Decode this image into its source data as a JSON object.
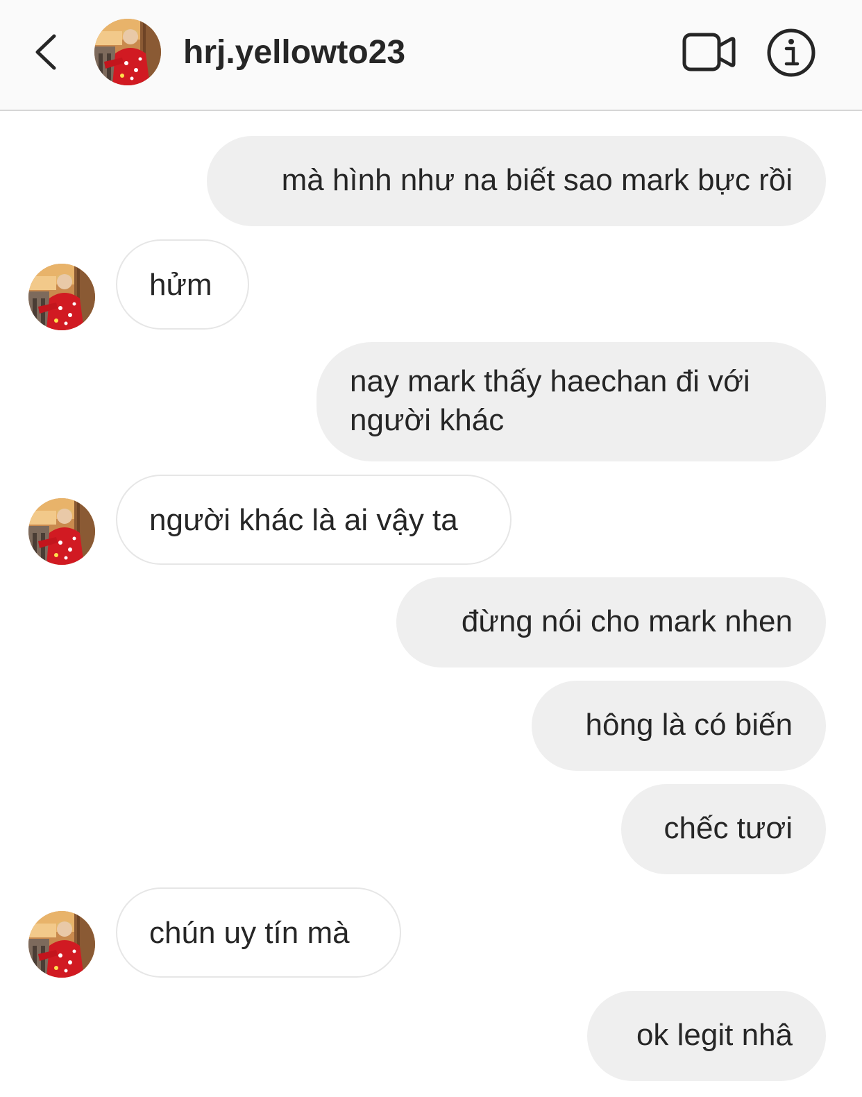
{
  "header": {
    "username": "hrj.yellowto23",
    "back_icon": "chevron-left-icon",
    "video_icon": "video-camera-icon",
    "info_icon": "info-icon"
  },
  "messages": [
    {
      "direction": "outgoing",
      "text": "mà hình như na biết sao mark bực rồi"
    },
    {
      "direction": "incoming",
      "text": "hửm"
    },
    {
      "direction": "outgoing",
      "text": "nay mark thấy haechan đi với người khác"
    },
    {
      "direction": "incoming",
      "text": "người khác là ai vậy ta"
    },
    {
      "direction": "outgoing",
      "text": "đừng nói cho mark nhen"
    },
    {
      "direction": "outgoing",
      "text": "hông là có biến"
    },
    {
      "direction": "outgoing",
      "text": "chếc tươi"
    },
    {
      "direction": "incoming",
      "text": "chún uy tín mà"
    },
    {
      "direction": "outgoing",
      "text": "ok legit nhâ"
    }
  ],
  "colors": {
    "outgoing_bubble": "#efefef",
    "incoming_border": "#e6e6e6",
    "header_bg": "#fafafa",
    "text": "#262626"
  }
}
